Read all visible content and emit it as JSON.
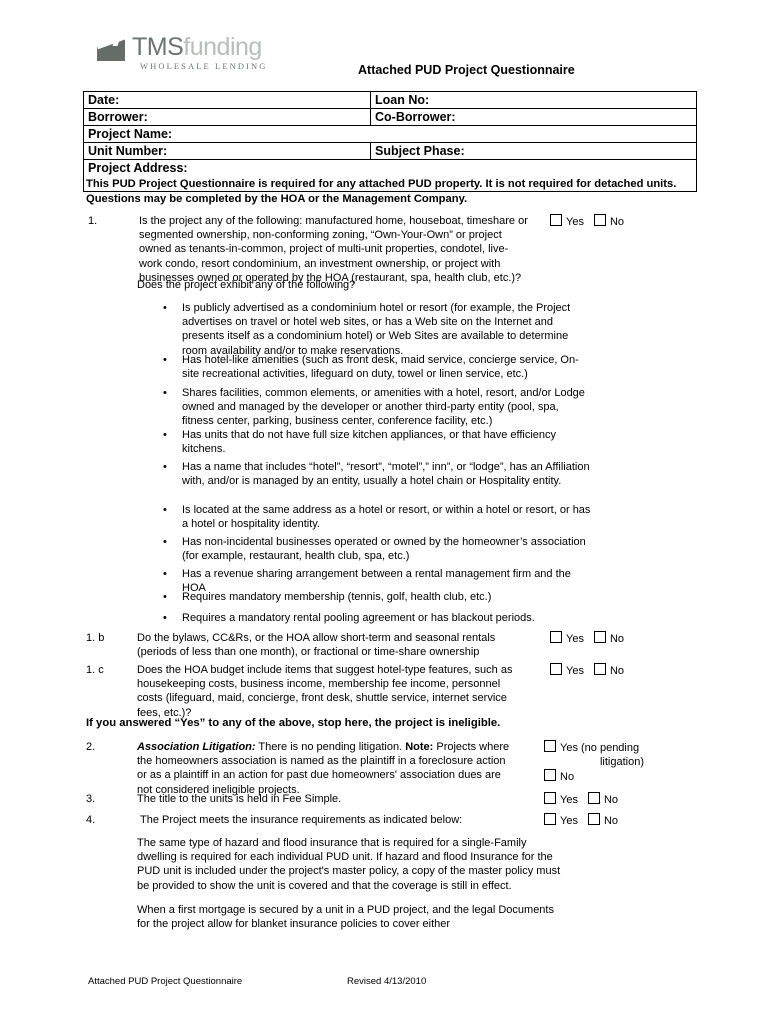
{
  "header": {
    "logo_primary": "TMS",
    "logo_secondary": "funding",
    "logo_tagline": "WHOLESALE LENDING",
    "doc_title": "Attached PUD Project Questionnaire",
    "logo_color_dark": "#6d7470",
    "logo_color_light": "#b9bdba"
  },
  "info_table": {
    "rows": [
      {
        "left": "Date:",
        "right": "Loan No:"
      },
      {
        "left": "Borrower:",
        "right": "Co-Borrower:"
      },
      {
        "left": "Project Name:",
        "right": ""
      },
      {
        "left": "Unit Number:",
        "right": "Subject Phase:"
      },
      {
        "left": "Project Address:",
        "right": ""
      }
    ]
  },
  "intro": "This PUD Project Questionnaire is required for any attached PUD property. It is not required for detached units.  Questions may be completed by the HOA or the Management Company.",
  "questions": {
    "q1": {
      "num": "1.",
      "text": "Is the project any of the following: manufactured home, houseboat, timeshare or segmented ownership, non-conforming zoning, “Own-Your-Own” or project owned as tenants-in-common, project of multi-unit properties, condotel, live-work condo, resort condominium, an investment ownership, or project with businesses owned or operated by the HOA (restaurant, spa, health club, etc.)?",
      "yes": "Yes",
      "no": "No"
    },
    "q1_followup": "Does the project exhibit any of the following?",
    "bullets": [
      "Is publicly advertised as a condominium hotel or resort (for example, the Project advertises on travel or hotel web sites, or has a Web site on the Internet and presents itself as a condominium hotel) or Web Sites are available to determine room availability and/or to make reservations.",
      "Has hotel-like amenities (such as front desk, maid service, concierge service, On-site recreational activities, lifeguard on duty, towel or linen service, etc.)",
      "Shares facilities, common elements, or amenities with a hotel, resort, and/or Lodge owned and managed by the developer or another third-party entity (pool, spa, fitness center, parking, business center, conference facility, etc.)",
      "Has units that do not have full size kitchen appliances, or that have efficiency kitchens.",
      "Has a name that includes “hotel”, “resort”, “motel”,” inn”, or “lodge”, has an Affiliation with, and/or is managed by an entity, usually a hotel chain or Hospitality entity.",
      "Is located at the same address as a hotel or resort, or within a hotel or resort,  or has a hotel or hospitality identity.",
      "Has non-incidental businesses operated or owned by the homeowner’s  association (for example, restaurant, health club, spa, etc.)",
      "Has a revenue sharing arrangement between a rental management firm and the HOA",
      "Requires mandatory membership (tennis, golf, health club, etc.)",
      "Requires a mandatory rental pooling agreement or has blackout periods."
    ],
    "q1b": {
      "num": "1. b",
      "text": "Do the bylaws, CC&Rs, or the HOA allow short-term and seasonal rentals (periods of less than one month), or fractional or time-share ownership",
      "yes": "Yes",
      "no": "No"
    },
    "q1c": {
      "num": "1. c",
      "text": "Does the HOA budget include items that suggest hotel-type features, such as housekeeping costs, business income, membership fee income, personnel costs (lifeguard, maid, concierge, front desk, shuttle service, internet service fees, etc.)?",
      "yes": "Yes",
      "no": "No"
    },
    "ineligible_statement": "If you answered “Yes” to any of the above, stop here, the project is ineligible.",
    "q2": {
      "num": "2.",
      "label": "Association Litigation:",
      "text_part1": " There is no pending litigation. ",
      "note_label": "Note:",
      "text_part2": " Projects where the homeowners association is named as the plaintiff in a foreclosure action or as a plaintiff in an action for past due homeowners' association dues are not considered ineligible projects.",
      "yes": "Yes (no pending",
      "yes_cont": "litigation)",
      "no": "No"
    },
    "q3": {
      "num": "3.",
      "text": "The title to the units is held in Fee Simple.",
      "yes": "Yes",
      "no": "No"
    },
    "q4": {
      "num": "4.",
      "text": "The Project meets the insurance requirements as indicated below:",
      "yes": "Yes",
      "no": "No"
    },
    "insurance_para1": "The same type of hazard and flood insurance that is required for a single-Family dwelling is required for each individual PUD unit. If hazard and flood Insurance for the PUD unit is included under the project's master policy, a copy of the master policy must be provided to show the unit is covered and that the coverage is still in effect.",
    "insurance_para2": "When a first mortgage is secured by a unit in a PUD project, and the legal Documents for the project allow for blanket insurance policies to cover either"
  },
  "footer": {
    "left": "Attached PUD Project Questionnaire",
    "right": "Revised 4/13/2010"
  }
}
